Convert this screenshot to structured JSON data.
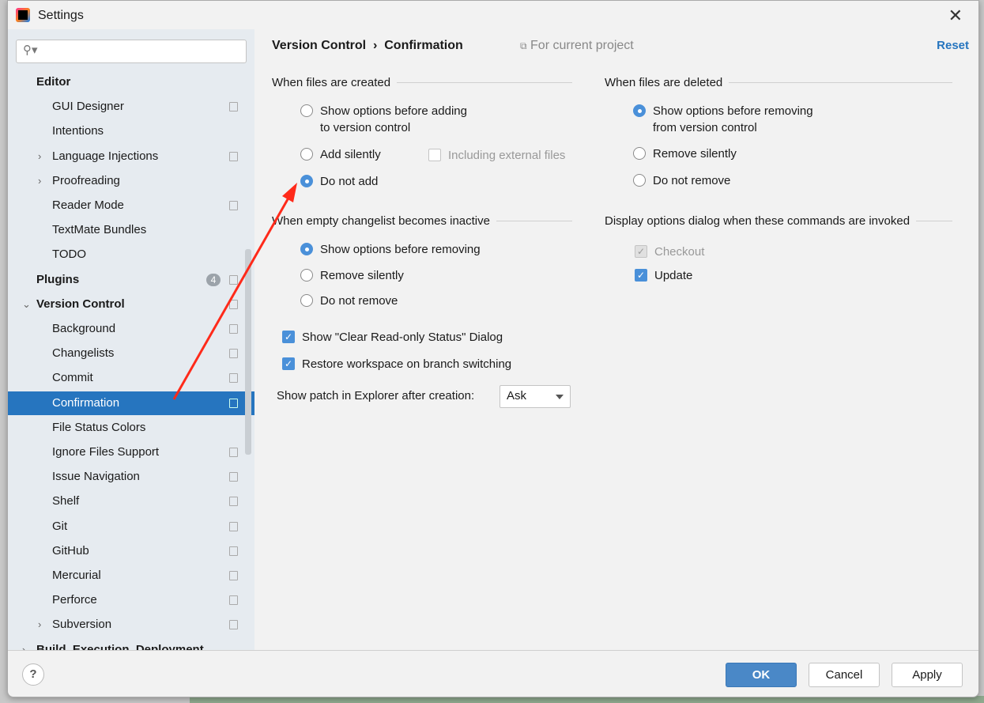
{
  "window": {
    "title": "Settings",
    "close": "✕"
  },
  "sidebar": {
    "search_placeholder": "",
    "items": [
      {
        "label": "Editor",
        "level": 0,
        "bold": true
      },
      {
        "label": "GUI Designer",
        "level": 1,
        "copy": true
      },
      {
        "label": "Intentions",
        "level": 1
      },
      {
        "label": "Language Injections",
        "level": 1,
        "chev": "›",
        "copy": true
      },
      {
        "label": "Proofreading",
        "level": 1,
        "chev": "›"
      },
      {
        "label": "Reader Mode",
        "level": 1,
        "copy": true
      },
      {
        "label": "TextMate Bundles",
        "level": 1
      },
      {
        "label": "TODO",
        "level": 1
      },
      {
        "label": "Plugins",
        "level": 0,
        "bold": true,
        "badge": "4",
        "copy": true
      },
      {
        "label": "Version Control",
        "level": 0,
        "bold": true,
        "chev": "⌄",
        "copy": true
      },
      {
        "label": "Background",
        "level": 1,
        "copy": true
      },
      {
        "label": "Changelists",
        "level": 1,
        "copy": true
      },
      {
        "label": "Commit",
        "level": 1,
        "copy": true
      },
      {
        "label": "Confirmation",
        "level": 1,
        "copy": true,
        "selected": true
      },
      {
        "label": "File Status Colors",
        "level": 1
      },
      {
        "label": "Ignore Files Support",
        "level": 1,
        "copy": true
      },
      {
        "label": "Issue Navigation",
        "level": 1,
        "copy": true
      },
      {
        "label": "Shelf",
        "level": 1,
        "copy": true
      },
      {
        "label": "Git",
        "level": 1,
        "copy": true
      },
      {
        "label": "GitHub",
        "level": 1,
        "copy": true
      },
      {
        "label": "Mercurial",
        "level": 1,
        "copy": true
      },
      {
        "label": "Perforce",
        "level": 1,
        "copy": true
      },
      {
        "label": "Subversion",
        "level": 1,
        "chev": "›",
        "copy": true
      },
      {
        "label": "Build, Execution, Deployment",
        "level": 0,
        "bold": true,
        "chev": "›"
      }
    ]
  },
  "main": {
    "breadcrumb": [
      "Version Control",
      "›",
      "Confirmation"
    ],
    "for_current_project": "For current project",
    "reset": "Reset",
    "created": {
      "title": "When files are created",
      "options": [
        "Show options before adding\nto version control",
        "Add silently",
        "Do not add"
      ],
      "selected": 2,
      "including_external": "Including external files"
    },
    "deleted": {
      "title": "When files are deleted",
      "options": [
        "Show options before removing\nfrom version control",
        "Remove silently",
        "Do not remove"
      ],
      "selected": 0
    },
    "changelist": {
      "title": "When empty changelist becomes inactive",
      "options": [
        "Show options before removing",
        "Remove silently",
        "Do not remove"
      ],
      "selected": 0
    },
    "display": {
      "title": "Display options dialog when these commands are invoked",
      "checkout": "Checkout",
      "update": "Update"
    },
    "clear_readonly": "Show \"Clear Read-only Status\" Dialog",
    "restore_workspace": "Restore workspace on branch switching",
    "patch_label": "Show patch in Explorer after creation:",
    "patch_value": "Ask"
  },
  "footer": {
    "help": "?",
    "ok": "OK",
    "cancel": "Cancel",
    "apply": "Apply"
  },
  "colors": {
    "accent": "#2675bf",
    "annotation_arrow": "#ff2a1a"
  }
}
